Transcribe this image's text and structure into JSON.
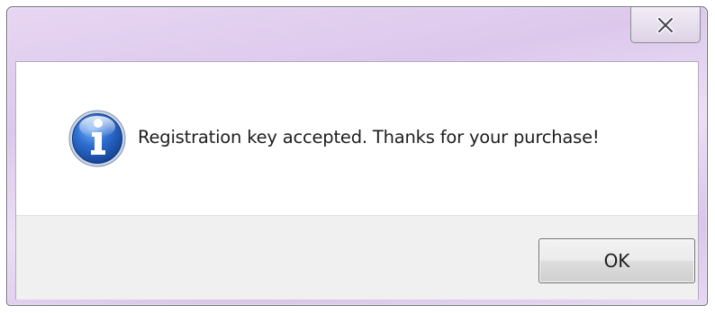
{
  "dialog": {
    "message": "Registration key accepted. Thanks for your purchase!",
    "icon": "info-icon",
    "ok_label": "OK",
    "close_icon": "close-icon"
  },
  "colors": {
    "frame": "#dcc8ec",
    "footer": "#f0f0f0",
    "icon_blue": "#1f5fc2"
  }
}
